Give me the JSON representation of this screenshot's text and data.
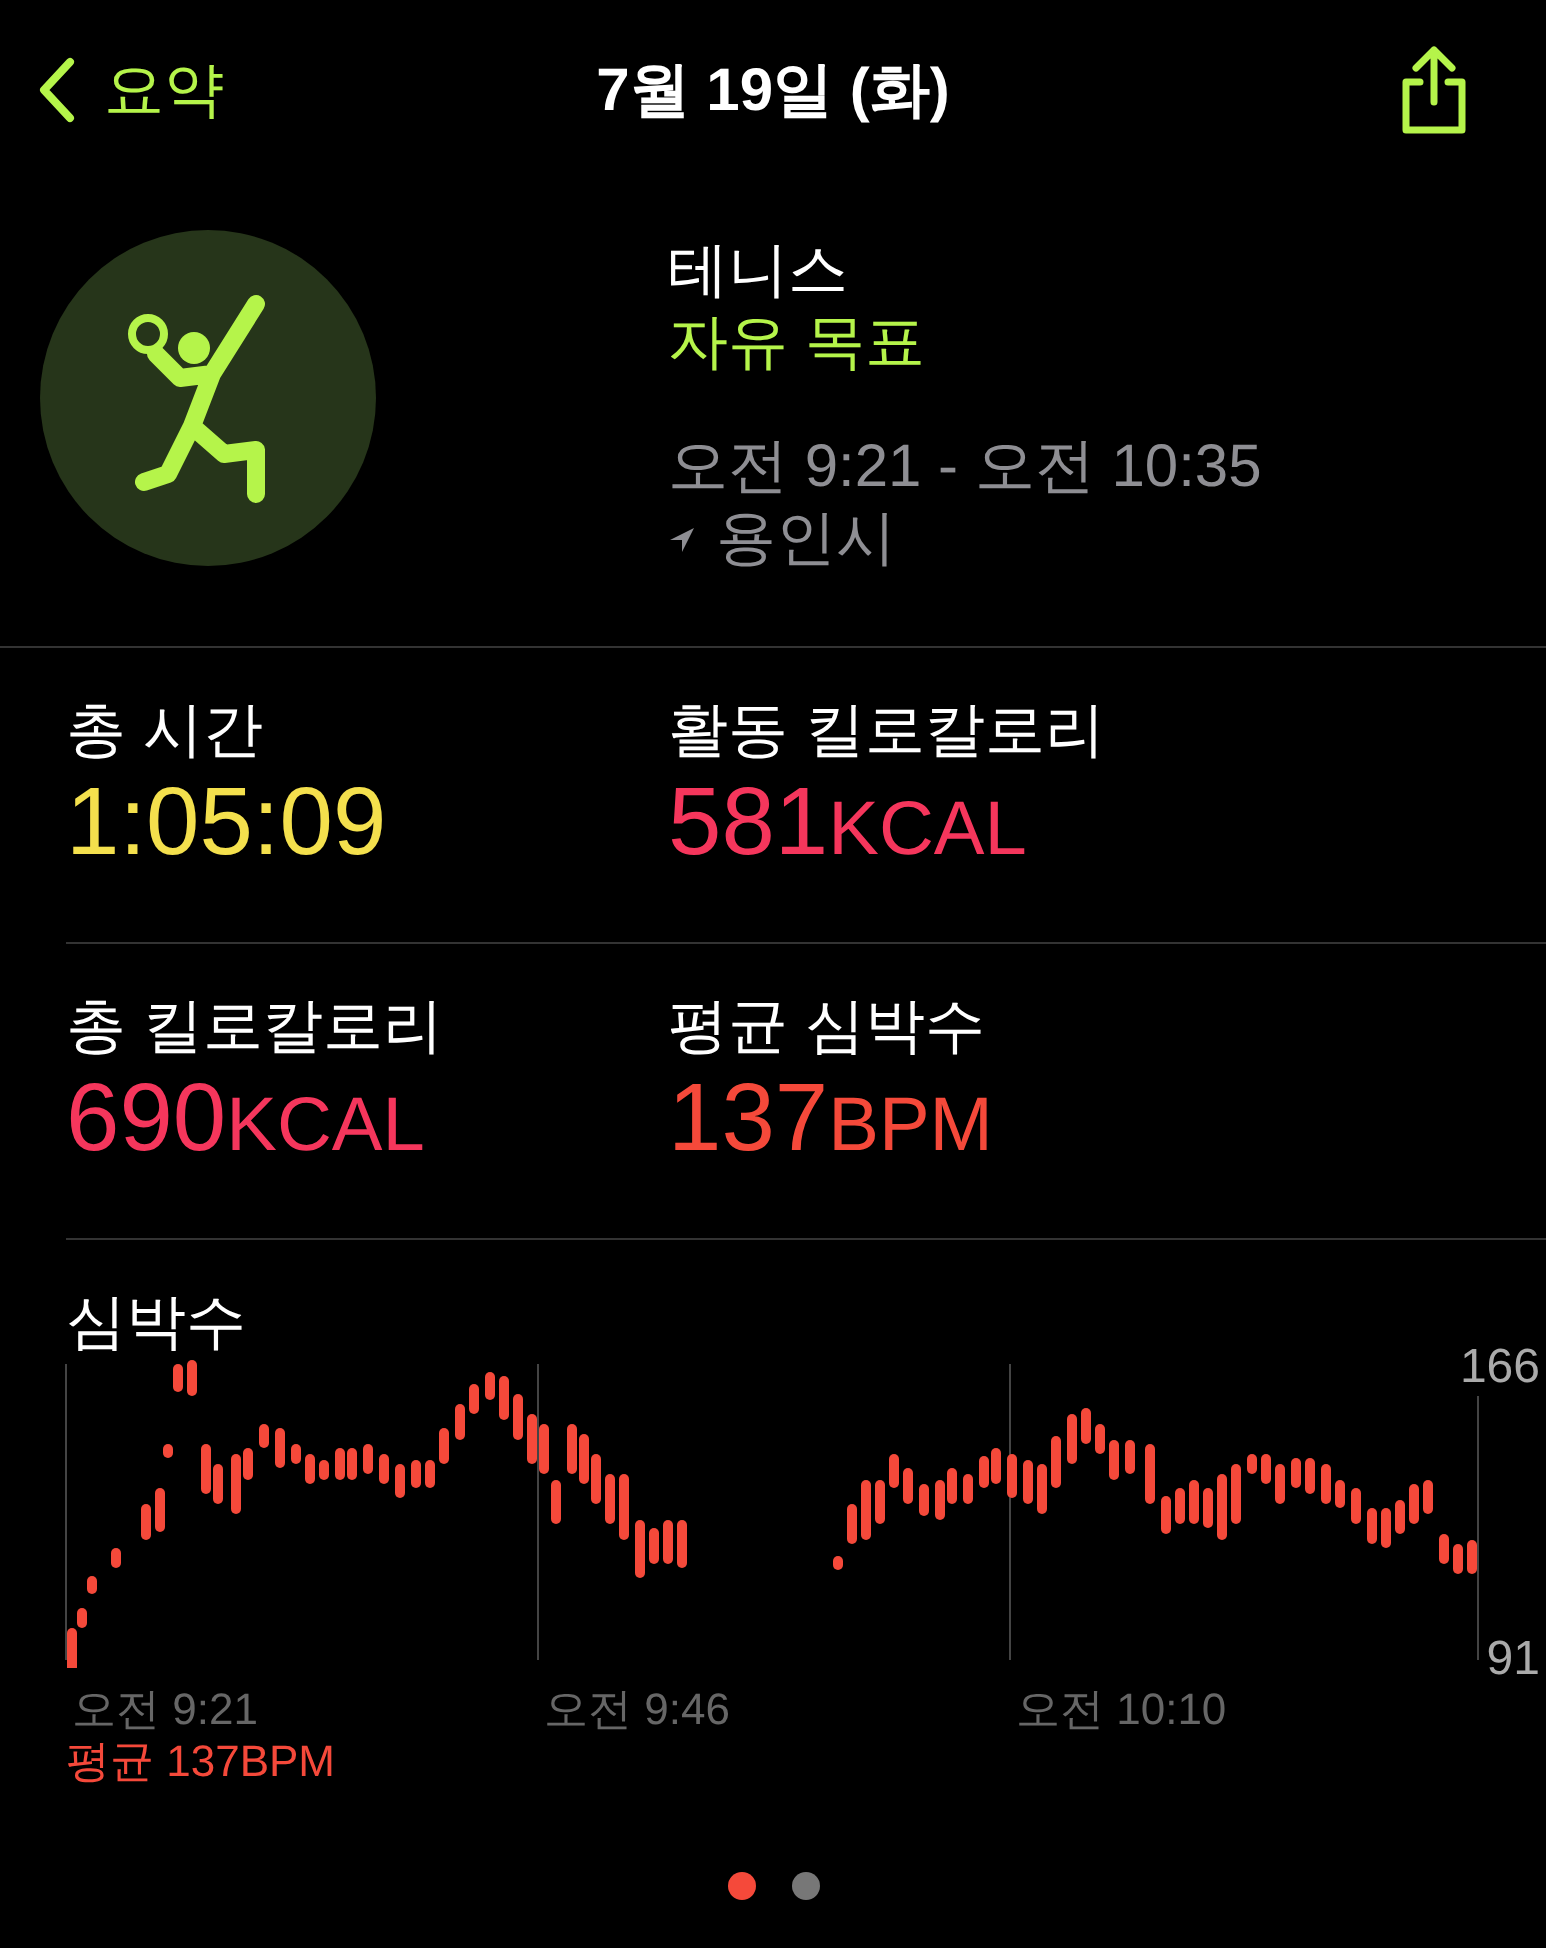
{
  "nav": {
    "back_label": "요약",
    "title": "7월 19일 (화)"
  },
  "workout": {
    "name": "테니스",
    "goal": "자유 목표",
    "time_range": "오전 9:21 - 오전 10:35",
    "location": "용인시"
  },
  "metrics": [
    {
      "label": "총 시간",
      "value": "1:05:09",
      "color": "#f4e04d"
    },
    {
      "label": "활동 킬로칼로리",
      "value": "581",
      "unit": "KCAL",
      "color": "#f5365c"
    },
    {
      "label": "총 킬로칼로리",
      "value": "690",
      "unit": "KCAL",
      "color": "#f5365c"
    },
    {
      "label": "평균 심박수",
      "value": "137",
      "unit": "BPM",
      "color": "#f5493a"
    }
  ],
  "heart_rate": {
    "title": "심박수",
    "y_max": "166",
    "y_min": "91",
    "x_labels": [
      "오전 9:21",
      "오전 9:46",
      "오전 10:10"
    ],
    "average": "평균 137BPM"
  },
  "page_dots": [
    {
      "selected": true
    },
    {
      "selected": false
    }
  ]
}
